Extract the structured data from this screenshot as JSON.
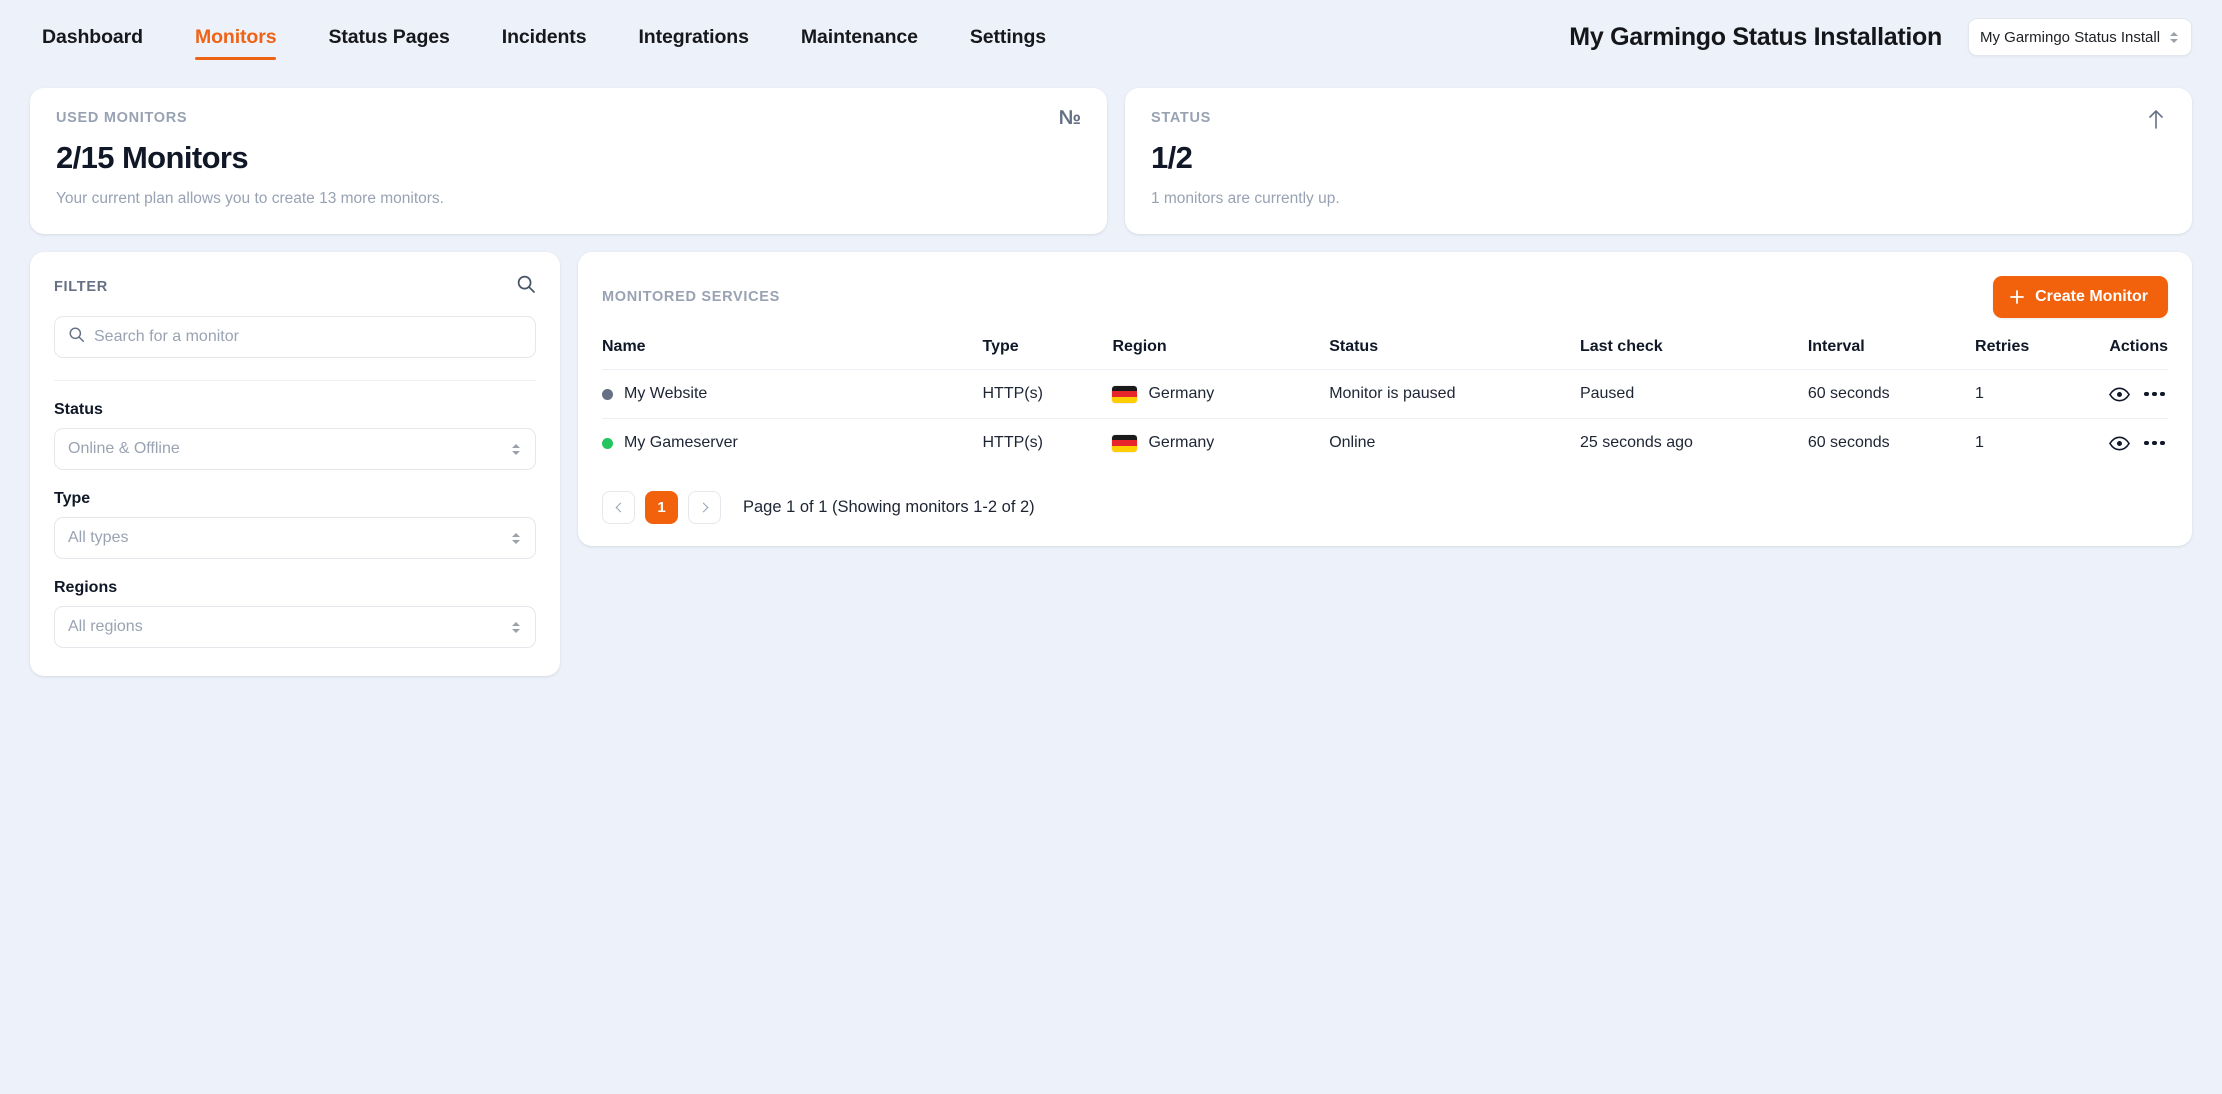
{
  "nav": {
    "items": [
      {
        "label": "Dashboard",
        "active": false
      },
      {
        "label": "Monitors",
        "active": true
      },
      {
        "label": "Status Pages",
        "active": false
      },
      {
        "label": "Incidents",
        "active": false
      },
      {
        "label": "Integrations",
        "active": false
      },
      {
        "label": "Maintenance",
        "active": false
      },
      {
        "label": "Settings",
        "active": false
      }
    ],
    "installation_title": "My Garmingo Status Installation",
    "installation_select_value": "My Garmingo Status Install"
  },
  "stats": {
    "used_monitors": {
      "label": "USED MONITORS",
      "value": "2/15 Monitors",
      "sub": "Your current plan allows you to create 13 more monitors.",
      "icon": "numero-icon",
      "icon_glyph": "№"
    },
    "status": {
      "label": "STATUS",
      "value": "1/2",
      "sub": "1 monitors are currently up.",
      "icon": "arrow-up-icon"
    }
  },
  "filter": {
    "title": "FILTER",
    "search_placeholder": "Search for a monitor",
    "search_value": "",
    "fields": [
      {
        "label": "Status",
        "value": "Online & Offline"
      },
      {
        "label": "Type",
        "value": "All types"
      },
      {
        "label": "Regions",
        "value": "All regions"
      }
    ]
  },
  "services": {
    "title": "MONITORED SERVICES",
    "create_button": "Create Monitor",
    "columns": [
      "Name",
      "Type",
      "Region",
      "Status",
      "Last check",
      "Interval",
      "Retries",
      "Actions"
    ],
    "rows": [
      {
        "name": "My Website",
        "status_dot_color": "#667085",
        "type": "HTTP(s)",
        "region": "Germany",
        "region_flag": "de",
        "status": "Monitor is paused",
        "last_check": "Paused",
        "interval": "60 seconds",
        "retries": "1"
      },
      {
        "name": "My Gameserver",
        "status_dot_color": "#22c55e",
        "type": "HTTP(s)",
        "region": "Germany",
        "region_flag": "de",
        "status": "Online",
        "last_check": "25 seconds ago",
        "interval": "60 seconds",
        "retries": "1"
      }
    ],
    "pagination": {
      "current_page": "1",
      "info": "Page 1 of 1 (Showing monitors 1-2 of 2)"
    }
  },
  "colors": {
    "accent": "#f2610c",
    "background": "#edf1f9",
    "card": "#ffffff",
    "online": "#22c55e",
    "paused": "#667085"
  }
}
